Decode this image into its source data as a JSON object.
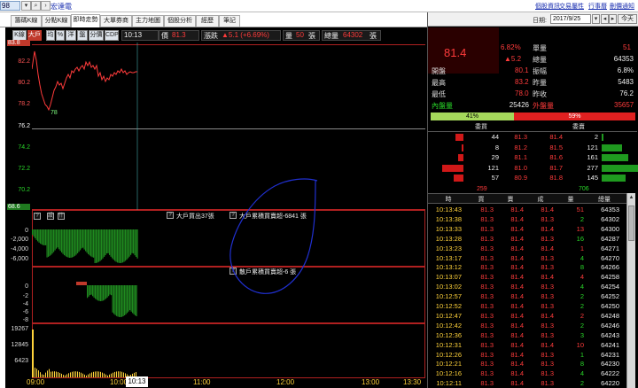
{
  "toolbar": {
    "code": "98",
    "stock_name": "宏達電",
    "links": [
      "個股資訊",
      "交易屬性",
      "行事曆",
      "刪價通知"
    ]
  },
  "tabs": [
    "籌碼K線",
    "分點K線",
    "即時走勢",
    "大單券商",
    "主力地圖",
    "個股分析",
    "經歷",
    "筆記"
  ],
  "active_tab": "即時走勢",
  "infobar": {
    "buttons": [
      "K線",
      "大戶",
      "均",
      "%",
      "洋",
      "盤",
      "分價",
      "CDP"
    ],
    "time": "10:13",
    "price_label": "價",
    "price": "81.3",
    "change_label": "漲跌",
    "change": "▲5.1 (+6.69%)",
    "vol_label": "量",
    "vol": "50",
    "vol_unit": "張",
    "total_label": "總量",
    "total": "64302",
    "total_unit": "張"
  },
  "price_axis": {
    "upper": [
      "83.8",
      "82.2",
      "80.2",
      "78.2"
    ],
    "lower": [
      "76.2",
      "74.2",
      "72.2",
      "70.2",
      "68.6"
    ],
    "low_mark": "78"
  },
  "indicator1": {
    "buttons": [
      "?",
      "設",
      "什"
    ],
    "labels": [
      "0",
      "-2,000",
      "-4,000",
      "-6,000"
    ],
    "ann1": "大戶買出37張",
    "ann2": "大戶累積買賣超-6841 張"
  },
  "indicator2": {
    "labels": [
      "0",
      "-2",
      "-4",
      "-6",
      "-8"
    ],
    "ann": "散戶累積買賣超-6 張"
  },
  "volume": {
    "labels": [
      "19267",
      "12845",
      "6423"
    ]
  },
  "x_axis": [
    "09:00",
    "10:00",
    "11:00",
    "12:00",
    "13:00",
    "13:30"
  ],
  "cursor_time": "10:13",
  "right": {
    "date_label": "日期:",
    "date": "2017/9/25",
    "today_btn": "今天",
    "price": "81.4",
    "pct": "6.82%",
    "chg": "▲5.2",
    "single_label": "單量",
    "single": "51",
    "total_label": "總量",
    "total": "64353",
    "stats": [
      {
        "l1": "開盤",
        "v1": "80.1",
        "l2": "振幅",
        "v2": "6.8%"
      },
      {
        "l1": "最高",
        "v1": "83.2",
        "l2": "昨量",
        "v2": "5483"
      },
      {
        "l1": "最低",
        "v1": "78.0",
        "l2": "昨收",
        "v2": "76.2"
      }
    ],
    "inner_label": "內盤量",
    "inner": "25426",
    "outer_label": "外盤量",
    "outer": "35657",
    "bar_left": "41%",
    "bar_right": "59%",
    "ob_header": [
      "委買",
      "委賣"
    ],
    "orderbook": [
      {
        "bq": "44",
        "bp": "81.3",
        "ap": "81.4",
        "aq": "2"
      },
      {
        "bq": "8",
        "bp": "81.2",
        "ap": "81.5",
        "aq": "121"
      },
      {
        "bq": "29",
        "bp": "81.1",
        "ap": "81.6",
        "aq": "161"
      },
      {
        "bq": "121",
        "bp": "81.0",
        "ap": "81.7",
        "aq": "277"
      },
      {
        "bq": "57",
        "bp": "80.9",
        "ap": "81.8",
        "aq": "145"
      }
    ],
    "ob_sum_bid": "259",
    "ob_sum_ask": "706",
    "trade_header": [
      "時",
      "買",
      "賣",
      "成",
      "量",
      "總量"
    ],
    "trades": [
      [
        "10:13:43",
        "81.3",
        "81.4",
        "81.4",
        "51",
        "64353"
      ],
      [
        "10:13:38",
        "81.3",
        "81.4",
        "81.3",
        "2",
        "64302"
      ],
      [
        "10:13:33",
        "81.3",
        "81.4",
        "81.4",
        "13",
        "64300"
      ],
      [
        "10:13:28",
        "81.3",
        "81.4",
        "81.3",
        "16",
        "64287"
      ],
      [
        "10:13:23",
        "81.3",
        "81.4",
        "81.4",
        "1",
        "64271"
      ],
      [
        "10:13:17",
        "81.3",
        "81.4",
        "81.3",
        "4",
        "64270"
      ],
      [
        "10:13:12",
        "81.3",
        "81.4",
        "81.3",
        "8",
        "64266"
      ],
      [
        "10:13:07",
        "81.3",
        "81.4",
        "81.4",
        "4",
        "64258"
      ],
      [
        "10:13:02",
        "81.3",
        "81.4",
        "81.3",
        "4",
        "64254"
      ],
      [
        "10:12:57",
        "81.3",
        "81.4",
        "81.3",
        "2",
        "64252"
      ],
      [
        "10:12:52",
        "81.3",
        "81.4",
        "81.3",
        "2",
        "64250"
      ],
      [
        "10:12:47",
        "81.3",
        "81.4",
        "81.4",
        "2",
        "64248"
      ],
      [
        "10:12:42",
        "81.3",
        "81.4",
        "81.3",
        "2",
        "64246"
      ],
      [
        "10:12:36",
        "81.3",
        "81.4",
        "81.3",
        "3",
        "64243"
      ],
      [
        "10:12:31",
        "81.3",
        "81.4",
        "81.4",
        "10",
        "64241"
      ],
      [
        "10:12:26",
        "81.3",
        "81.4",
        "81.3",
        "1",
        "64231"
      ],
      [
        "10:12:21",
        "81.3",
        "81.4",
        "81.3",
        "8",
        "64230"
      ],
      [
        "10:12:16",
        "81.3",
        "81.4",
        "81.3",
        "4",
        "64222"
      ],
      [
        "10:12:11",
        "81.3",
        "81.4",
        "81.3",
        "2",
        "64220"
      ]
    ]
  }
}
